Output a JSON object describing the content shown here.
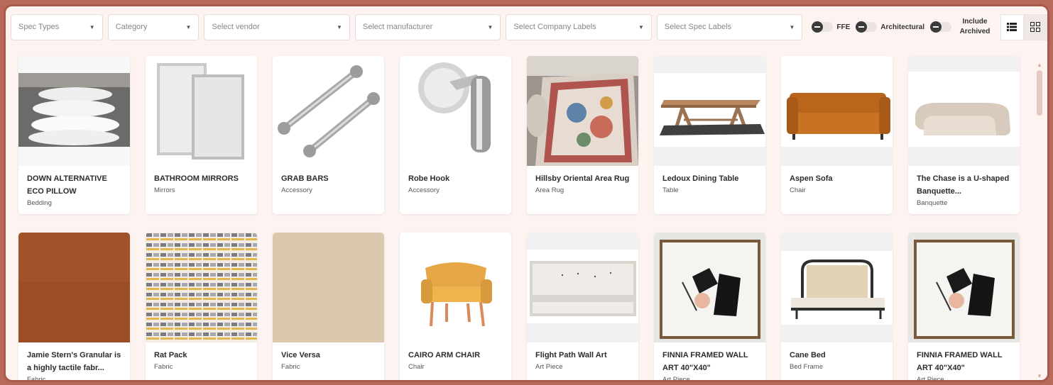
{
  "filters": {
    "spec_types": "Spec Types",
    "category": "Category",
    "vendor": "Select vendor",
    "manufacturer": "Select manufacturer",
    "company_labels": "Select Company Labels",
    "spec_labels": "Select Spec Labels"
  },
  "toggles": {
    "ffe": "FFE",
    "architectural": "Architectural",
    "include_archived": "Include Archived"
  },
  "icons": {
    "caret": "▼",
    "list_view": "list-view-icon",
    "grid_view": "grid-view-icon"
  },
  "colors": {
    "frame_border": "#a95947",
    "background": "#fdf4f1",
    "accent": "#b9695a"
  },
  "products": [
    {
      "name": "DOWN ALTERNATIVE ECO PILLOW",
      "category": "Bedding"
    },
    {
      "name": "BATHROOM MIRRORS",
      "category": "Mirrors"
    },
    {
      "name": "GRAB BARS",
      "category": "Accessory"
    },
    {
      "name": "Robe Hook",
      "category": "Accessory"
    },
    {
      "name": "Hillsby Oriental Area Rug",
      "category": "Area Rug"
    },
    {
      "name": "Ledoux Dining Table",
      "category": "Table"
    },
    {
      "name": "Aspen Sofa",
      "category": "Chair"
    },
    {
      "name": "The Chase is a U-shaped Banquette...",
      "category": "Banquette"
    },
    {
      "name": "Jamie Stern's Granular is a highly tactile fabr...",
      "category": "Fabric"
    },
    {
      "name": "Rat Pack",
      "category": "Fabric"
    },
    {
      "name": "Vice Versa",
      "category": "Fabric"
    },
    {
      "name": "CAIRO ARM CHAIR",
      "category": "Chair"
    },
    {
      "name": "Flight Path Wall Art",
      "category": "Art Piece"
    },
    {
      "name": "FINNIA FRAMED WALL ART 40\"X40\"",
      "category": "Art Piece"
    },
    {
      "name": "Cane Bed",
      "category": "Bed Frame"
    },
    {
      "name": "FINNIA FRAMED WALL ART 40\"X40\"",
      "category": "Art Piece"
    }
  ]
}
